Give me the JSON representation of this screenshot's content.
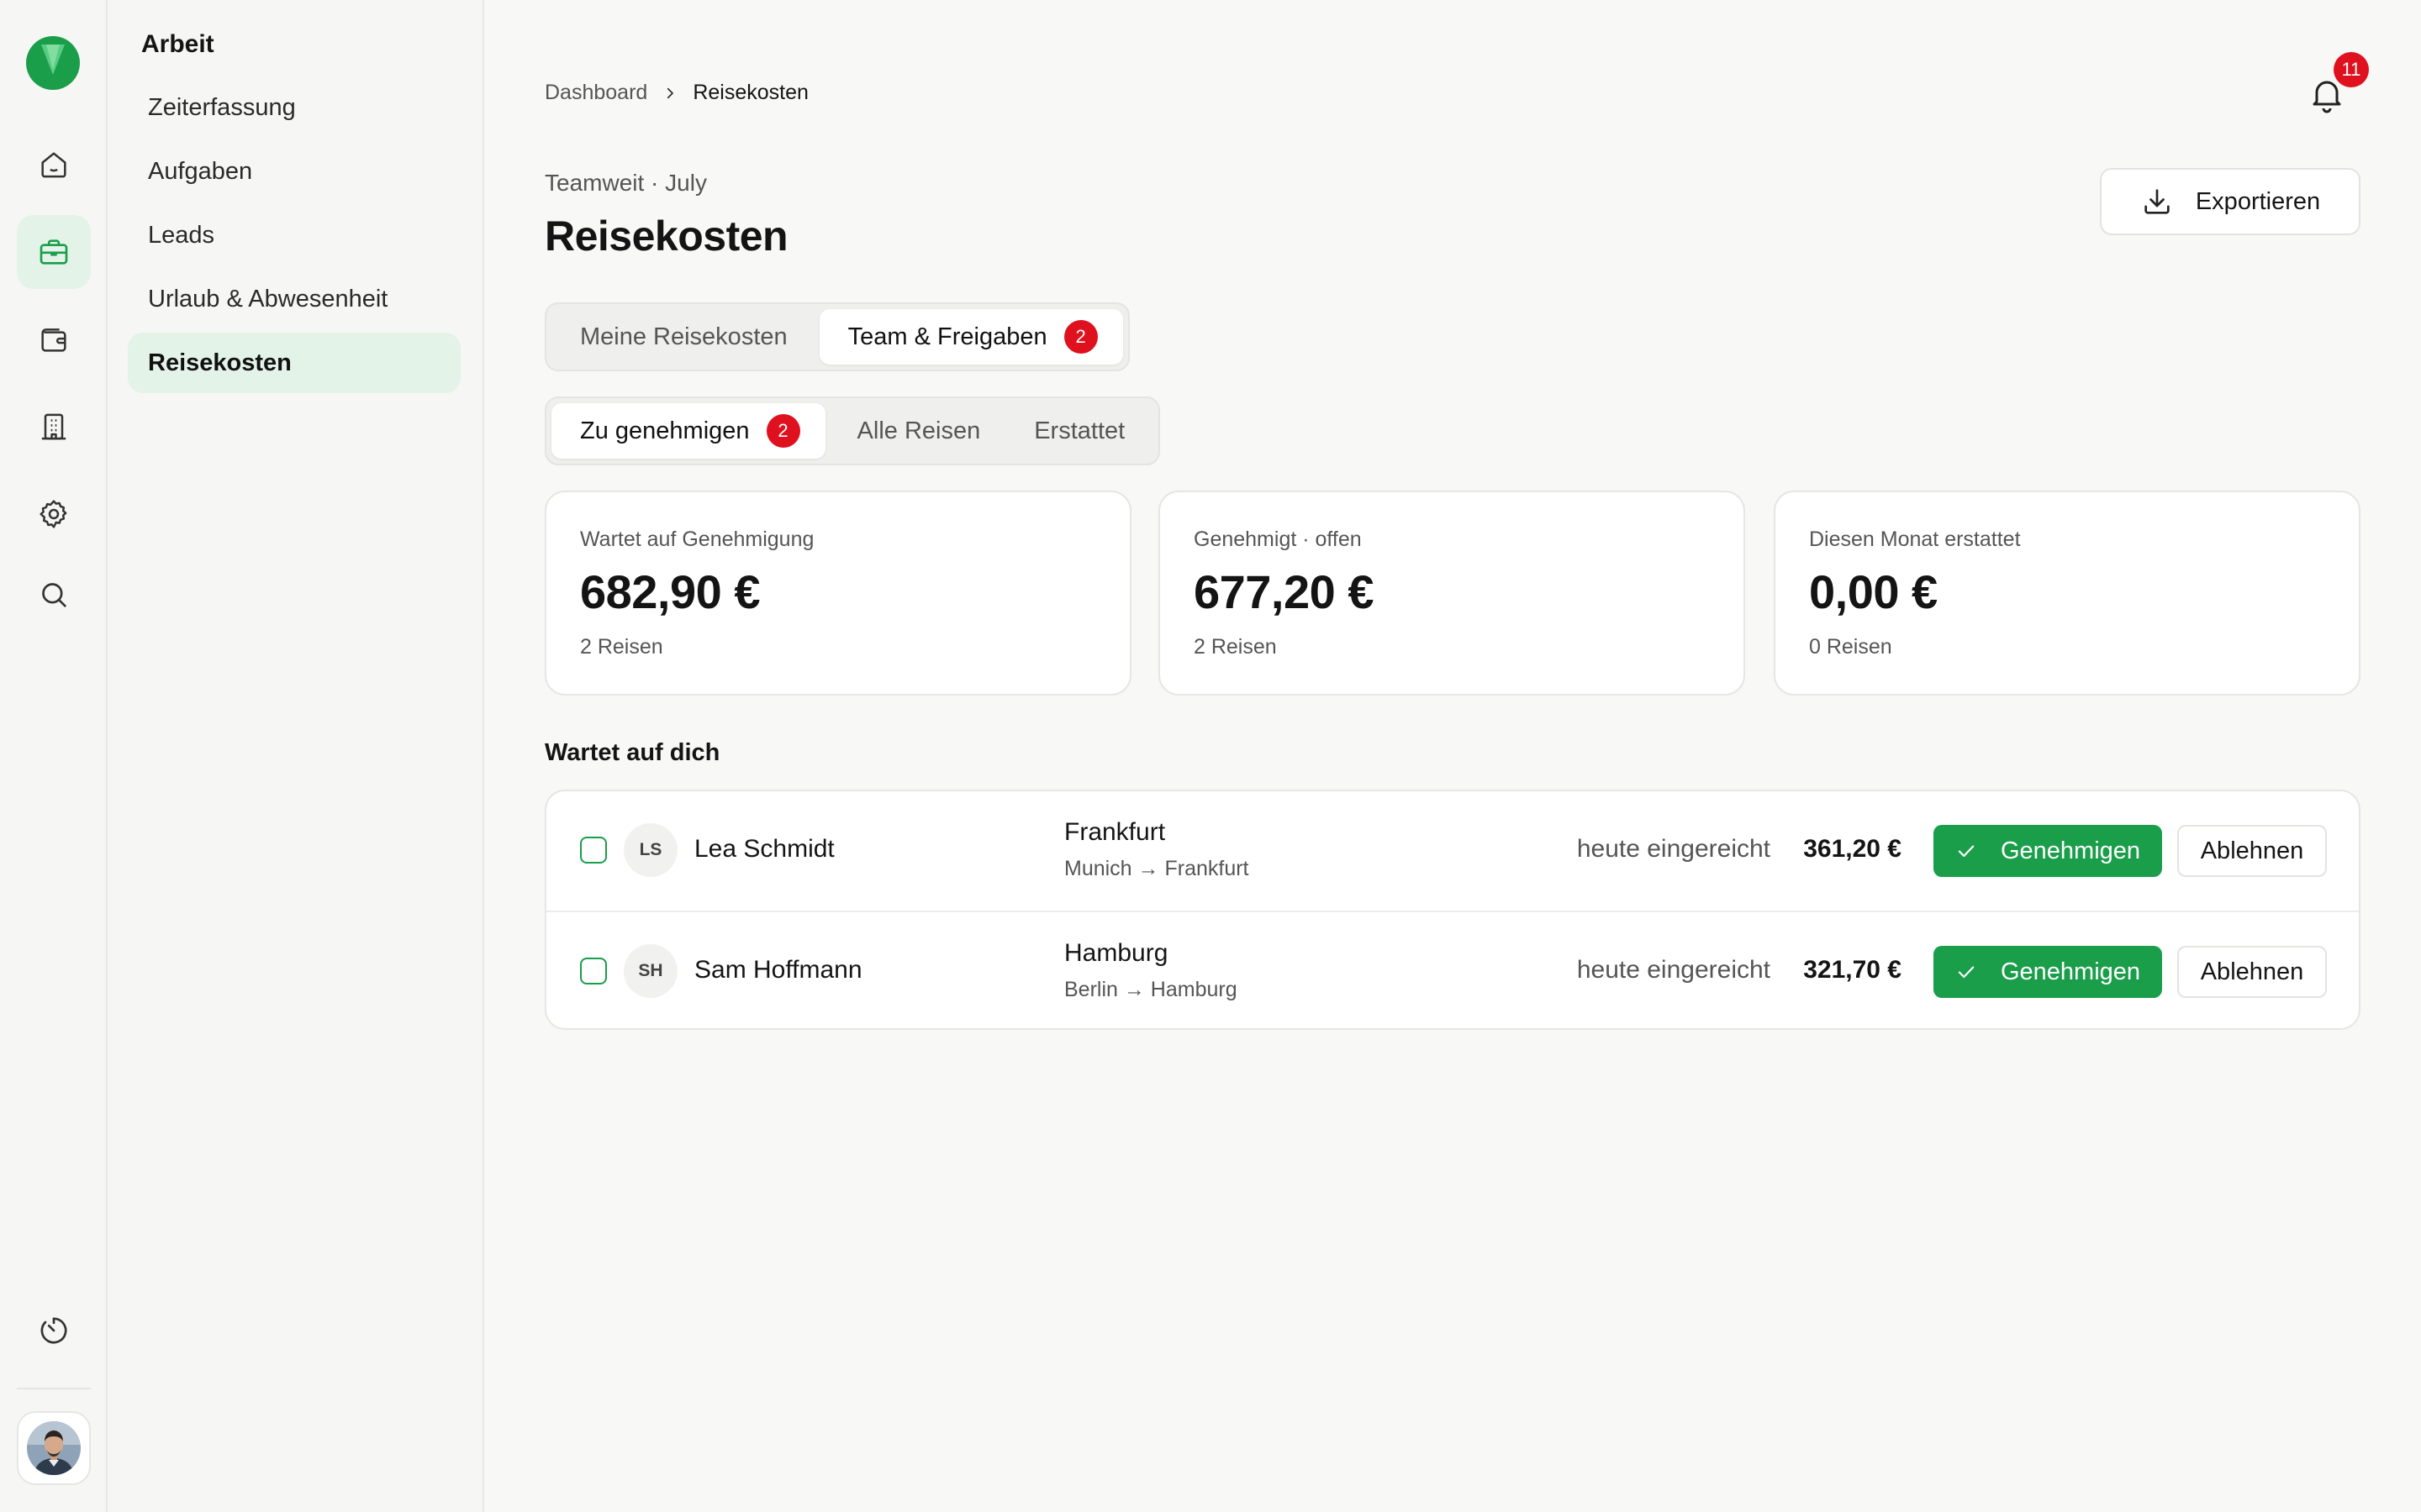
{
  "colors": {
    "accent": "#1a9e4a",
    "badge": "#e0111e",
    "active_bg": "#e4f3e8"
  },
  "rail": {
    "icons": [
      "home-icon",
      "briefcase-icon",
      "wallet-icon",
      "building-icon",
      "gear-icon",
      "search-icon",
      "timer-icon"
    ],
    "active": "briefcase-icon"
  },
  "subnav": {
    "title": "Arbeit",
    "items": [
      {
        "label": "Zeiterfassung"
      },
      {
        "label": "Aufgaben"
      },
      {
        "label": "Leads"
      },
      {
        "label": "Urlaub & Abwesenheit"
      },
      {
        "label": "Reisekosten",
        "active": true
      }
    ]
  },
  "header": {
    "breadcrumb": [
      "Dashboard",
      "Reisekosten"
    ],
    "notification_count": "11",
    "eyebrow": "Teamweit · July",
    "title": "Reisekosten",
    "export_label": "Exportieren"
  },
  "tabs": [
    {
      "label": "Meine Reisekosten"
    },
    {
      "label": "Team & Freigaben",
      "badge": "2",
      "active": true
    }
  ],
  "filters": [
    {
      "label": "Zu genehmigen",
      "badge": "2",
      "active": true
    },
    {
      "label": "Alle Reisen"
    },
    {
      "label": "Erstattet"
    }
  ],
  "stats": [
    {
      "label": "Wartet auf Genehmigung",
      "value": "682,90 €",
      "sub": "2 Reisen"
    },
    {
      "label": "Genehmigt · offen",
      "value": "677,20 €",
      "sub": "2 Reisen"
    },
    {
      "label": "Diesen Monat erstattet",
      "value": "0,00 €",
      "sub": "0 Reisen"
    }
  ],
  "pending": {
    "title": "Wartet auf dich",
    "approve_label": "Genehmigen",
    "reject_label": "Ablehnen",
    "rows": [
      {
        "initials": "LS",
        "name": "Lea Schmidt",
        "destination": "Frankfurt",
        "route": "Munich → Frankfurt",
        "submitted": "heute eingereicht",
        "amount": "361,20 €"
      },
      {
        "initials": "SH",
        "name": "Sam Hoffmann",
        "destination": "Hamburg",
        "route": "Berlin → Hamburg",
        "submitted": "heute eingereicht",
        "amount": "321,70 €"
      }
    ]
  }
}
